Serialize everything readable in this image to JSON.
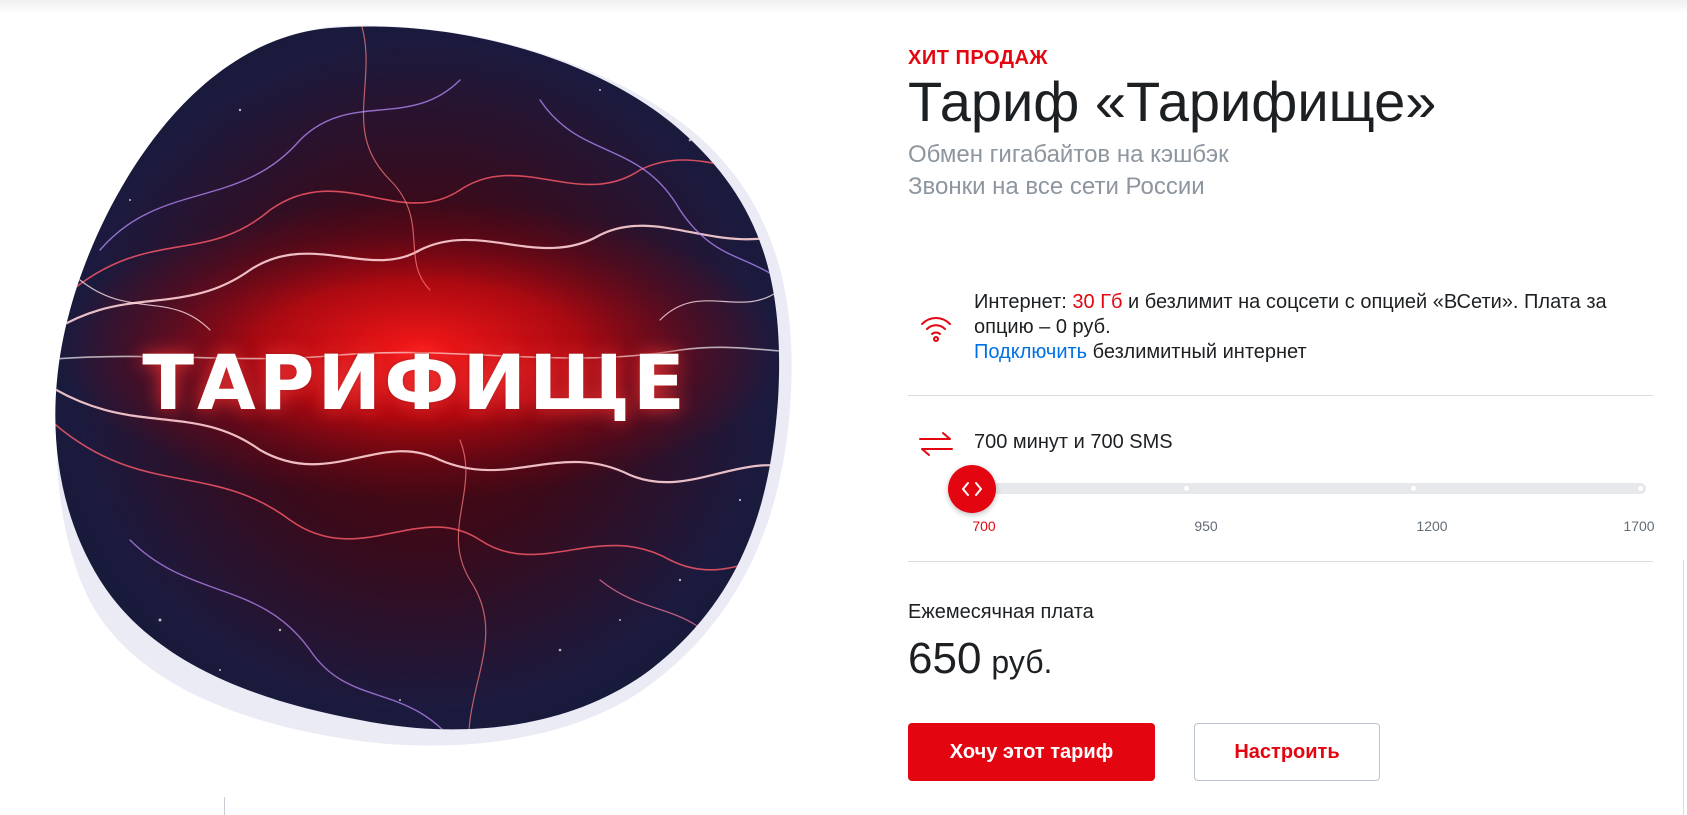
{
  "hero": {
    "image_label": "ТАРИФИЩЕ"
  },
  "tariff": {
    "badge": "ХИТ ПРОДАЖ",
    "title": "Тариф «Тарифище»",
    "subtitle_lines": [
      "Обмен гигабайтов на кэшбэк",
      "Звонки на все сети России"
    ]
  },
  "internet": {
    "icon": "wifi-icon",
    "prefix": "Интернет: ",
    "volume": "30 Гб",
    "description": " и безлимит на соцсети с опцией «ВСети». Плата за опцию – 0 руб.",
    "link_label": "Подключить",
    "link_suffix": " безлимитный интернет"
  },
  "minutes": {
    "icon": "arrows-exchange-icon",
    "text": "700 минут и 700 SMS",
    "slider": {
      "ticks": [
        "700",
        "950",
        "1200",
        "1700"
      ],
      "selected": "700"
    }
  },
  "pricing": {
    "label": "Ежемесячная плата",
    "value": "650",
    "unit": "руб."
  },
  "actions": {
    "primary_label": "Хочу этот тариф",
    "secondary_label": "Настроить"
  },
  "colors": {
    "accent": "#e30611",
    "link": "#0070e5",
    "muted": "#8d969f",
    "text": "#1d2023"
  }
}
